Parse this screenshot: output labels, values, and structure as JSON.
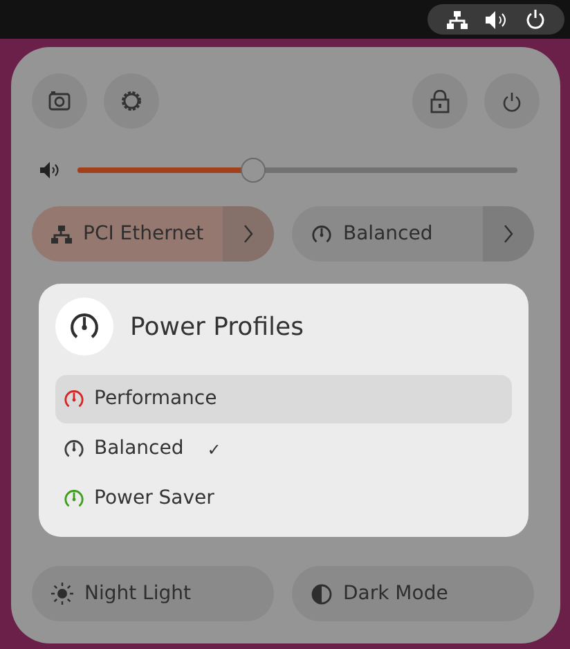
{
  "volume": {
    "level": 0.4
  },
  "toggles": [
    {
      "label": "PCI Ethernet",
      "kind": "network",
      "active": true,
      "menu": true
    },
    {
      "label": "Balanced",
      "kind": "power",
      "active": false,
      "menu": true
    },
    {
      "label": "Night Light",
      "kind": "night",
      "active": false,
      "menu": false
    },
    {
      "label": "Dark Mode",
      "kind": "dark",
      "active": false,
      "menu": false
    }
  ],
  "popover": {
    "title": "Power Profiles",
    "check_mark": "✓",
    "items": [
      {
        "label": "Performance",
        "color": "#d52525",
        "selected": false,
        "highlighted": true
      },
      {
        "label": "Balanced",
        "color": "#3d3d3d",
        "selected": true,
        "highlighted": false
      },
      {
        "label": "Power Saver",
        "color": "#3d9d1d",
        "selected": false,
        "highlighted": false
      }
    ]
  }
}
